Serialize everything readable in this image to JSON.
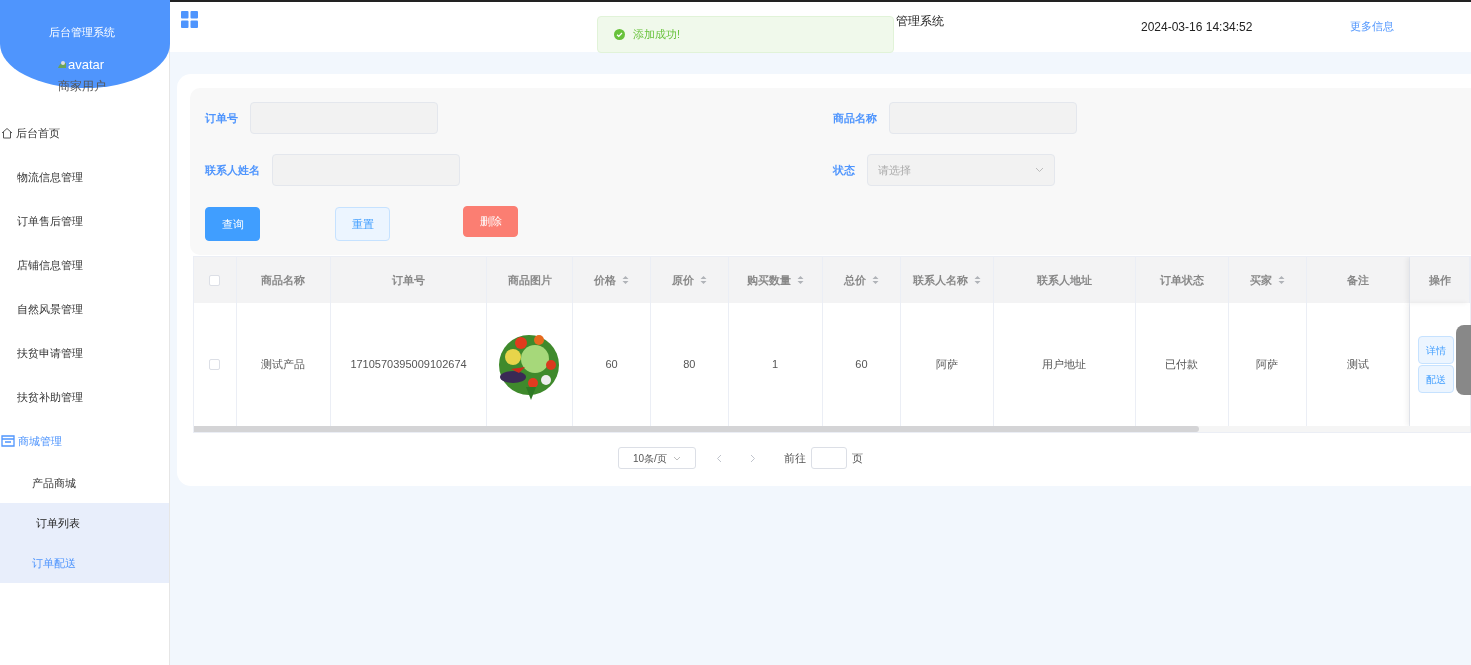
{
  "brand": {
    "title": "后台管理系统",
    "avatar_alt": "avatar",
    "user": "商家用户"
  },
  "header": {
    "title": "管理系统",
    "datetime": "2024-03-16 14:34:52",
    "more": "更多信息"
  },
  "toast": {
    "kind": "success",
    "message": "添加成功!"
  },
  "sidebar": {
    "items": [
      {
        "label": "后台首页",
        "kind": "home",
        "selected": false
      },
      {
        "label": "物流信息管理",
        "kind": "plain",
        "selected": false
      },
      {
        "label": "订单售后管理",
        "kind": "plain",
        "selected": false
      },
      {
        "label": "店铺信息管理",
        "kind": "plain",
        "selected": false
      },
      {
        "label": "自然风景管理",
        "kind": "plain",
        "selected": false
      },
      {
        "label": "扶贫申请管理",
        "kind": "plain",
        "selected": false
      },
      {
        "label": "扶贫补助管理",
        "kind": "plain",
        "selected": false
      },
      {
        "label": "商城管理",
        "kind": "shop",
        "selected": false,
        "children": [
          {
            "label": "产品商城",
            "selected": false,
            "highlighted": false
          },
          {
            "label": "订单列表",
            "selected": false,
            "highlighted": true
          },
          {
            "label": "订单配送",
            "selected": true,
            "highlighted": true
          }
        ]
      }
    ]
  },
  "search": {
    "fields": [
      {
        "label": "订单号",
        "kind": "input"
      },
      {
        "label": "商品名称",
        "kind": "input"
      },
      {
        "label": "联系人姓名",
        "kind": "input"
      },
      {
        "label": "状态",
        "kind": "select",
        "placeholder": "请选择"
      }
    ],
    "buttons": [
      {
        "label": "查询",
        "kind": "primary"
      },
      {
        "label": "重置",
        "kind": "plain"
      },
      {
        "label": "删除",
        "kind": "danger"
      }
    ]
  },
  "table": {
    "all_checked": false,
    "columns": [
      {
        "label": "商品名称",
        "sortable": false
      },
      {
        "label": "订单号",
        "sortable": false
      },
      {
        "label": "商品图片",
        "sortable": false
      },
      {
        "label": "价格",
        "sortable": true
      },
      {
        "label": "原价",
        "sortable": true
      },
      {
        "label": "购买数量",
        "sortable": true
      },
      {
        "label": "总价",
        "sortable": true
      },
      {
        "label": "联系人名称",
        "sortable": true
      },
      {
        "label": "联系人地址",
        "sortable": false
      },
      {
        "label": "订单状态",
        "sortable": false
      },
      {
        "label": "买家",
        "sortable": true
      },
      {
        "label": "备注",
        "sortable": false
      },
      {
        "label": "操作",
        "sortable": false
      }
    ],
    "rows": [
      {
        "checked": false,
        "cells": [
          "测试产品",
          "1710570395009102674",
          {
            "kind": "picture"
          },
          "60",
          "80",
          "1",
          "60",
          "阿萨",
          "用户地址",
          "已付款",
          "阿萨",
          "测试"
        ],
        "actions": [
          "详情",
          "配送"
        ]
      }
    ]
  },
  "pagination": {
    "page_size": "10条/页",
    "goto": "前往",
    "page_unit": "页"
  }
}
